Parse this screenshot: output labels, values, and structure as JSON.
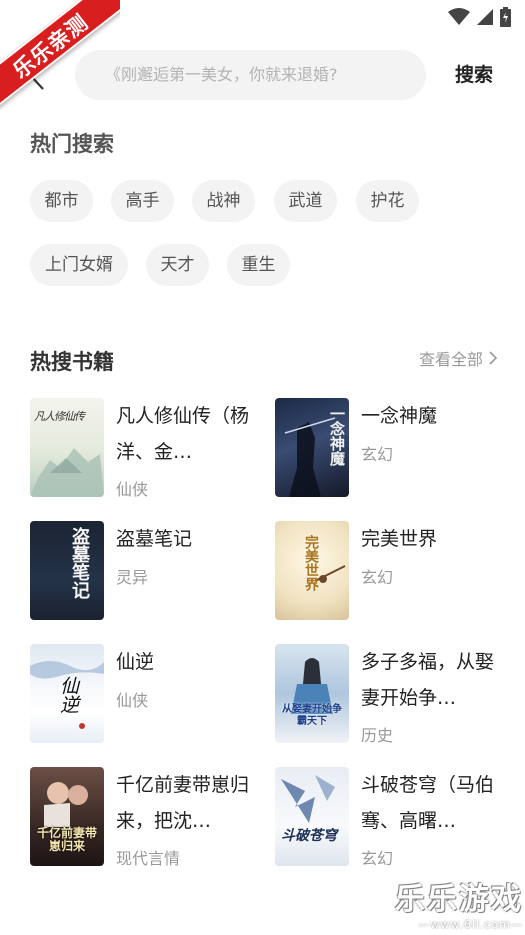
{
  "ribbon": {
    "text": "乐乐亲测"
  },
  "search": {
    "placeholder": "《刚邂逅第一美女，你就来退婚?",
    "button_label": "搜索"
  },
  "hot_search": {
    "title": "热门搜索",
    "tags": [
      "都市",
      "高手",
      "战神",
      "武道",
      "护花",
      "上门女婿",
      "天才",
      "重生"
    ]
  },
  "hot_books": {
    "title": "热搜书籍",
    "view_all": "查看全部",
    "books": [
      {
        "title": "凡人修仙传（杨洋、金…",
        "genre": "仙侠",
        "cover_text": "凡人修仙传"
      },
      {
        "title": "一念神魔",
        "genre": "玄幻",
        "cover_text": "一念神魔"
      },
      {
        "title": "盗墓笔记",
        "genre": "灵异",
        "cover_text": "盗墓笔记"
      },
      {
        "title": "完美世界",
        "genre": "玄幻",
        "cover_text": "完美世界"
      },
      {
        "title": "仙逆",
        "genre": "仙侠",
        "cover_text": "仙逆"
      },
      {
        "title": "多子多福，从娶妻开始争…",
        "genre": "历史",
        "cover_text": "从娶妻开始争霸天下"
      },
      {
        "title": "千亿前妻带崽归来，把沈…",
        "genre": "现代言情",
        "cover_text": "千亿前妻带崽归来"
      },
      {
        "title": "斗破苍穹（马伯骞、高曙…",
        "genre": "玄幻",
        "cover_text": "斗破苍穹"
      }
    ]
  },
  "watermark": {
    "brand": "乐乐游戏",
    "url": "—www.6ll.com—"
  },
  "colors": {
    "accent": "#d81e1e",
    "chip_bg": "#f3f3f3",
    "muted": "#999999"
  }
}
